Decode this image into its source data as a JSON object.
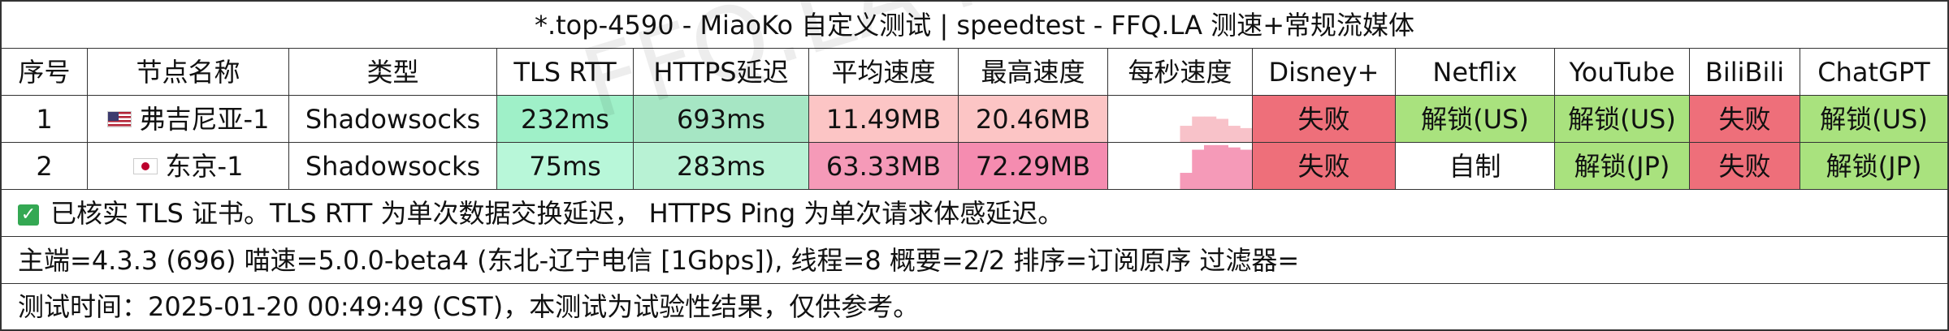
{
  "title": "*.top-4590 - MiaoKo 自定义测试 | speedtest - FFQ.LA 测速+常规流媒体",
  "headers": [
    "序号",
    "节点名称",
    "类型",
    "TLS RTT",
    "HTTPS延迟",
    "平均速度",
    "最高速度",
    "每秒速度",
    "Disney+",
    "Netflix",
    "YouTube",
    "BiliBili",
    "ChatGPT"
  ],
  "rows": [
    {
      "index": "1",
      "flag": "us-flag",
      "node": "弗吉尼亚-1",
      "type": "Shadowsocks",
      "tls_rtt": "232ms",
      "https_latency": "693ms",
      "avg_speed": "11.49MB",
      "max_speed": "20.46MB",
      "disney": "失败",
      "netflix": "解锁(US)",
      "youtube": "解锁(US)",
      "bilibili": "失败",
      "chatgpt": "解锁(US)",
      "colors": {
        "tls_rtt": "#9ff0c8",
        "https_latency": "#a6e6c4",
        "avg_speed": "#fcc5c5",
        "max_speed": "#fcc5c5",
        "disney": "#ee6f7a",
        "netflix": "#a9e27e",
        "youtube": "#a9e27e",
        "bilibili": "#ee6f7a",
        "chatgpt": "#a9e27e"
      },
      "sparkline": [
        0.0,
        0.0,
        0.0,
        0.0,
        0.0,
        0.0,
        0.35,
        0.55,
        0.55,
        0.5,
        0.35,
        0.3
      ]
    },
    {
      "index": "2",
      "flag": "jp-flag",
      "node": "东京-1",
      "type": "Shadowsocks",
      "tls_rtt": "75ms",
      "https_latency": "283ms",
      "avg_speed": "63.33MB",
      "max_speed": "72.29MB",
      "disney": "失败",
      "netflix": "自制",
      "youtube": "解锁(JP)",
      "bilibili": "失败",
      "chatgpt": "解锁(JP)",
      "colors": {
        "tls_rtt": "#b8f7d9",
        "https_latency": "#b8f2d4",
        "avg_speed": "#f59ab8",
        "max_speed": "#f58cb0",
        "disney": "#ee6f7a",
        "netflix": "#ffffff",
        "youtube": "#a9e27e",
        "bilibili": "#ee6f7a",
        "chatgpt": "#a9e27e"
      },
      "sparkline": [
        0.0,
        0.0,
        0.0,
        0.0,
        0.0,
        0.0,
        0.35,
        0.85,
        0.95,
        0.95,
        0.9,
        0.85
      ]
    }
  ],
  "info_lines": [
    "已核实 TLS 证书。TLS RTT 为单次数据交换延迟， HTTPS Ping 为单次请求体感延迟。",
    "主端=4.3.3 (696) 喵速=5.0.0-beta4 (东北-辽宁电信 [1Gbps]), 线程=8 概要=2/2 排序=订阅原序 过滤器=",
    "测试时间：2025-01-20 00:49:49 (CST)，本测试为试验性结果，仅供参考。"
  ],
  "watermark": "FFQ.LA Public Test Center",
  "theme": {
    "spark_color_row1": "#f8c2c9",
    "spark_color_row2": "#f59ab8",
    "check_color": "#34a853"
  }
}
